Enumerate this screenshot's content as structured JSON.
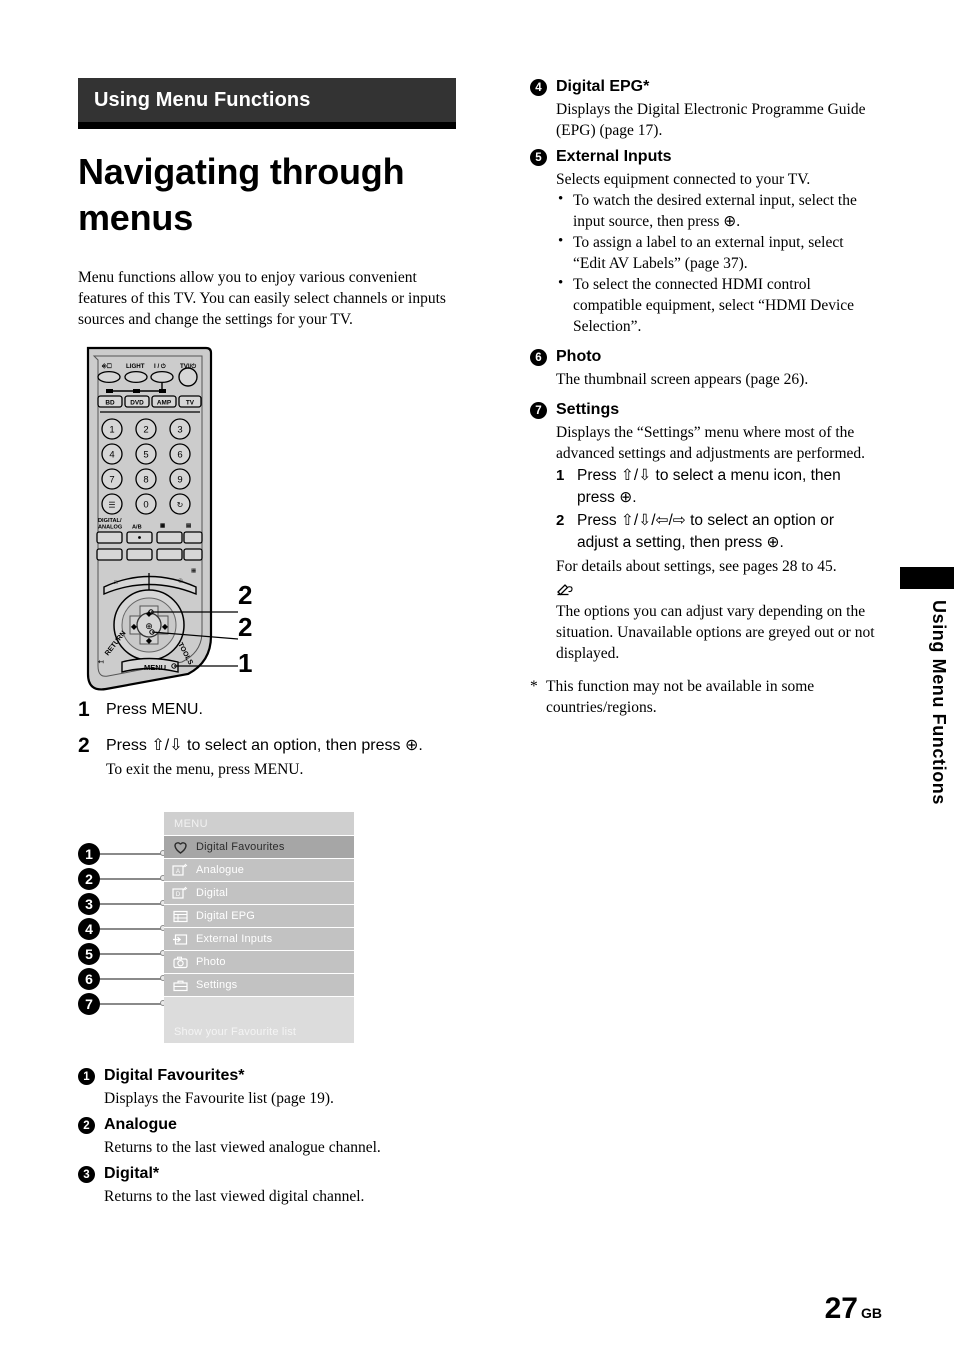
{
  "section_bar": {
    "label": "Using Menu Functions"
  },
  "chapter_title": "Navigating through menus",
  "intro": "Menu functions allow you to enjoy various convenient features of this TV. You can easily select channels or inputs sources and change the settings for your TV.",
  "remote": {
    "top_row": [
      "LIGHT"
    ],
    "device_buttons": [
      "BD",
      "DVD",
      "AMP",
      "TV"
    ],
    "keypad": [
      "1",
      "2",
      "3",
      "4",
      "5",
      "6",
      "7",
      "8",
      "9",
      "0"
    ],
    "labels": [
      "DIGITAL/",
      "ANALOG",
      "A/B"
    ],
    "nav_labels": {
      "return": "RETURN",
      "tools": "TOOLS",
      "menu": "MENU"
    },
    "callouts": [
      {
        "number": "2"
      },
      {
        "number": "2"
      },
      {
        "number": "1"
      }
    ]
  },
  "steps": [
    {
      "no": "1",
      "text": "Press MENU.",
      "sub": ""
    },
    {
      "no": "2",
      "text": "Press ⇧/⇩ to select an option, then press ⊕.",
      "sub": "To exit the menu, press MENU."
    }
  ],
  "menu_screen": {
    "header": "MENU",
    "footer_text": "Show your Favourite list",
    "rows": [
      {
        "callout": "1",
        "label": "Digital Favourites",
        "icon": "heart-icon",
        "selected": true
      },
      {
        "callout": "2",
        "label": "Analogue",
        "icon": "analogue-icon",
        "selected": false
      },
      {
        "callout": "3",
        "label": "Digital",
        "icon": "digital-icon",
        "selected": false
      },
      {
        "callout": "4",
        "label": "Digital EPG",
        "icon": "epg-grid-icon",
        "selected": false
      },
      {
        "callout": "5",
        "label": "External Inputs",
        "icon": "external-input-icon",
        "selected": false
      },
      {
        "callout": "6",
        "label": "Photo",
        "icon": "camera-icon",
        "selected": false
      },
      {
        "callout": "7",
        "label": "Settings",
        "icon": "toolbox-icon",
        "selected": false
      }
    ]
  },
  "items_left": [
    {
      "badge": "1",
      "title": "Digital Favourites*",
      "body": "Displays the Favourite list (page 19)."
    },
    {
      "badge": "2",
      "title": "Analogue",
      "body": "Returns to the last viewed analogue channel."
    },
    {
      "badge": "3",
      "title": "Digital*",
      "body": "Returns to the last viewed digital channel."
    }
  ],
  "items_right": [
    {
      "badge": "4",
      "title": "Digital EPG*",
      "body": "Displays the Digital Electronic Programme Guide (EPG) (page 17)."
    },
    {
      "badge": "5",
      "title": "External Inputs",
      "body": "Selects equipment connected to your TV.",
      "bullets": [
        "To watch the desired external input, select the input source, then press ⊕.",
        "To assign a label to an external input, select “Edit AV Labels” (page 37).",
        "To select the connected HDMI control compatible equipment, select “HDMI Device Selection”."
      ]
    },
    {
      "badge": "6",
      "title": "Photo",
      "body": "The thumbnail screen appears (page 26)."
    },
    {
      "badge": "7",
      "title": "Settings",
      "body": "Displays the “Settings” menu where most of the advanced settings and adjustments are performed.",
      "substeps": [
        {
          "no": "1",
          "text": "Press ⇧/⇩ to select a menu icon, then press ⊕."
        },
        {
          "no": "2",
          "text": "Press ⇧/⇩/⇦/⇨ to select an option or adjust a setting, then press ⊕."
        }
      ],
      "after": "For details about settings, see pages 28 to 45.",
      "note": "The options you can adjust vary depending on the situation. Unavailable options are greyed out or not displayed."
    }
  ],
  "footnote": {
    "star": "*",
    "text": "This function may not be available in some countries/regions."
  },
  "side_tab": {
    "label": "Using Menu Functions"
  },
  "footer": {
    "page_number": "27",
    "country_code": "GB"
  },
  "colors": {
    "section_bar_bg": "#333333",
    "section_bar_underline": "#000000",
    "menu_row_bg": "#c2c2c2",
    "menu_row_selected_bg": "#a6a6a6",
    "menu_panel_bg": "#cfcfcf",
    "menu_footer_bg": "#dcdcdc",
    "remote_body": "#cccccc"
  }
}
